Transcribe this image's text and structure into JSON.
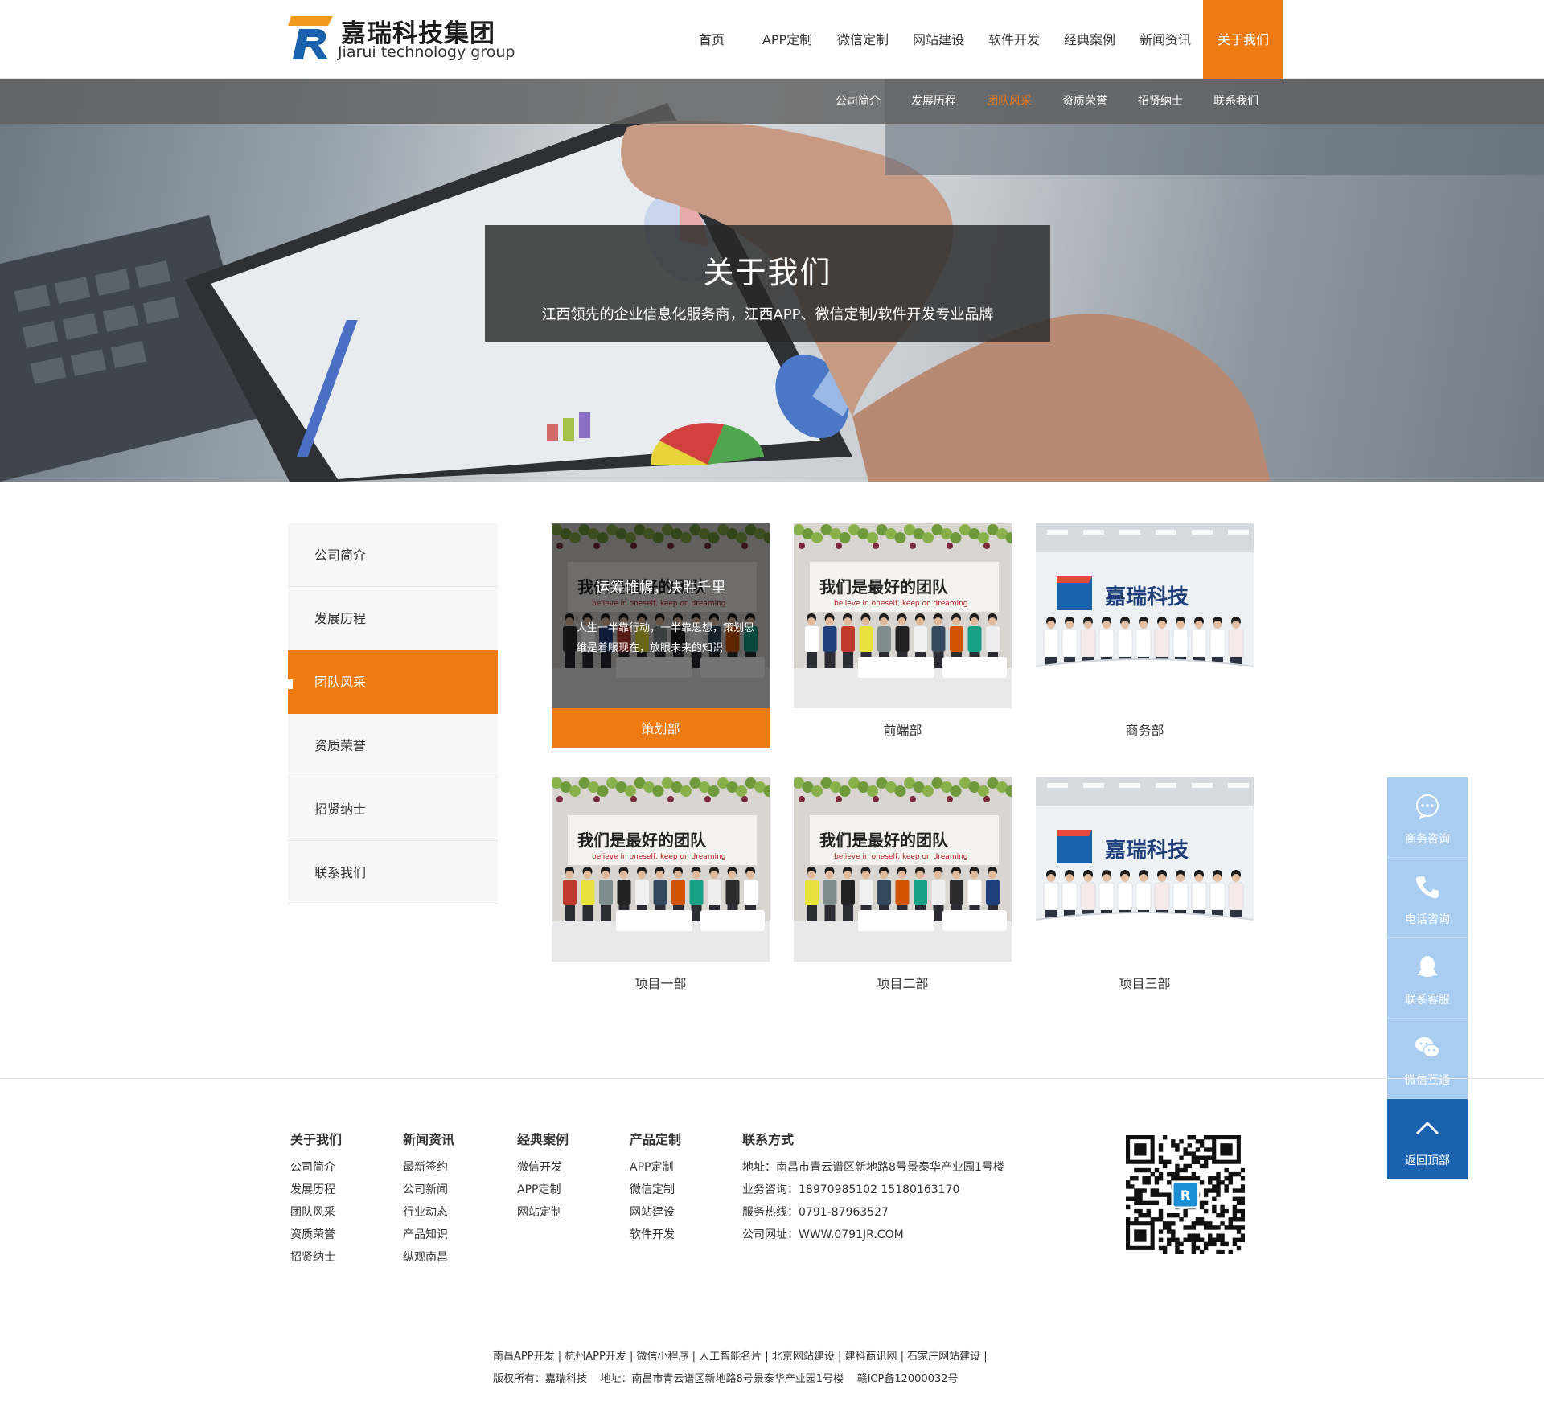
{
  "brand": {
    "name_cn": "嘉瑞科技集团",
    "name_en": "Jiarui technology group",
    "accent": "#ee7a12",
    "blue": "#1a62ad"
  },
  "nav": {
    "items": [
      "首页",
      "APP定制",
      "微信定制",
      "网站建设",
      "软件开发",
      "经典案例",
      "新闻资讯",
      "关于我们"
    ],
    "active": "关于我们"
  },
  "subnav": {
    "items": [
      "公司简介",
      "发展历程",
      "团队风采",
      "资质荣誉",
      "招贤纳士",
      "联系我们"
    ],
    "active": "团队风采"
  },
  "banner": {
    "title": "关于我们",
    "subtitle": "江西领先的企业信息化服务商，江西APP、微信定制/软件开发专业品牌"
  },
  "side_menu": {
    "items": [
      "公司简介",
      "发展历程",
      "团队风采",
      "资质荣誉",
      "招贤纳士",
      "联系我们"
    ],
    "active": "团队风采"
  },
  "gallery": {
    "hover_title": "运筹帷幄，决胜千里",
    "hover_text": "人生一半靠行动，一半靠思想，策划思维是着眼现在，放眼未来的知识",
    "photo_banner_text": "我们是最好的团队",
    "photo_banner_sub": "believe in oneself, keep on dreaming",
    "photo_brand_text": "嘉瑞科技",
    "cards": [
      {
        "label": "策划部",
        "photo": "team-wall"
      },
      {
        "label": "前端部",
        "photo": "team-wall"
      },
      {
        "label": "商务部",
        "photo": "brand-wall"
      },
      {
        "label": "项目一部",
        "photo": "team-wall"
      },
      {
        "label": "项目二部",
        "photo": "team-wall"
      },
      {
        "label": "项目三部",
        "photo": "brand-wall"
      }
    ]
  },
  "float_bar": {
    "items": [
      {
        "label": "商务咨询",
        "icon": "chat-bubble-icon"
      },
      {
        "label": "电话咨询",
        "icon": "phone-icon"
      },
      {
        "label": "联系客服",
        "icon": "qq-icon"
      },
      {
        "label": "微信互通",
        "icon": "wechat-icon"
      },
      {
        "label": "返回顶部",
        "icon": "arrow-up-icon"
      }
    ]
  },
  "footer": {
    "cols": [
      {
        "title": "关于我们",
        "links": [
          "公司简介",
          "发展历程",
          "团队风采",
          "资质荣誉",
          "招贤纳士"
        ]
      },
      {
        "title": "新闻资讯",
        "links": [
          "最新签约",
          "公司新闻",
          "行业动态",
          "产品知识",
          "纵观南昌"
        ]
      },
      {
        "title": "经典案例",
        "links": [
          "微信开发",
          "APP定制",
          "网站定制"
        ]
      },
      {
        "title": "产品定制",
        "links": [
          "APP定制",
          "微信定制",
          "网站建设",
          "软件开发"
        ]
      }
    ],
    "contact": {
      "title": "联系方式",
      "address": "地址：南昌市青云谱区新地路8号景泰华产业园1号楼",
      "business": "业务咨询：18970985102 15180163170",
      "hotline": "服务热线：0791-87963527",
      "site": "公司网址：WWW.0791JR.COM"
    },
    "friend_links": [
      "南昌APP开发",
      "杭州APP开发",
      "微信小程序",
      "人工智能名片",
      "北京网站建设",
      "建科商讯网",
      "石家庄网站建设"
    ],
    "copyright": "版权所有：嘉瑞科技    地址：南昌市青云谱区新地路8号景泰华产业园1号楼    赣ICP备12000032号"
  }
}
